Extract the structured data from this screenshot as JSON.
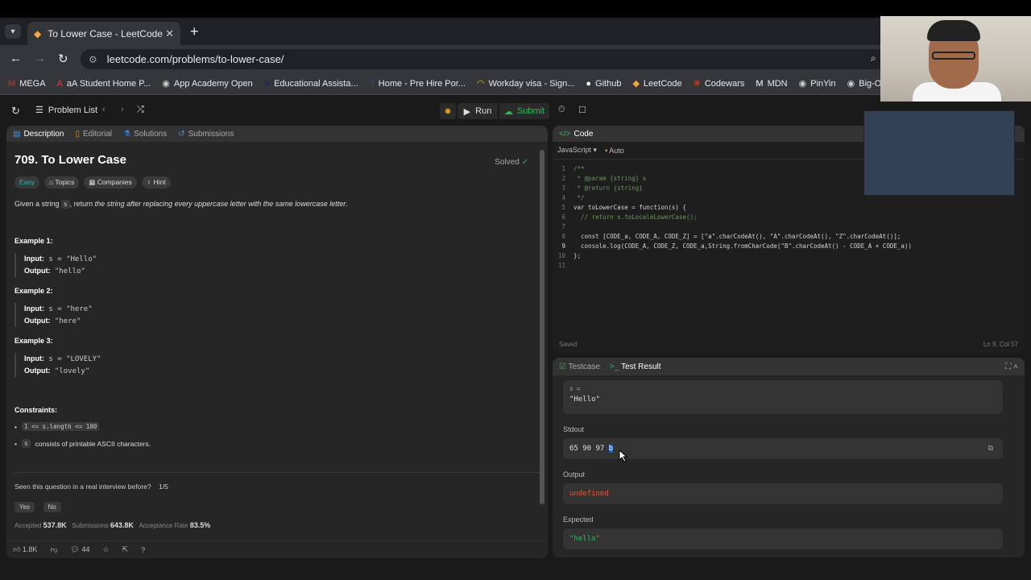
{
  "browser": {
    "tab_title": "To Lower Case - LeetCode",
    "url": "leetcode.com/problems/to-lower-case/",
    "bookmarks": [
      {
        "label": "MEGA",
        "icon": "mega-icon",
        "color": "#d9272e"
      },
      {
        "label": "aA Student Home P...",
        "icon": "aa-icon",
        "color": "#e03a3e"
      },
      {
        "label": "App Academy Open",
        "icon": "globe-icon",
        "color": "#cccccc"
      },
      {
        "label": "Educational Assista...",
        "icon": "visa-icon",
        "color": "#1a1f71"
      },
      {
        "label": "Home - Pre Hire Por...",
        "icon": "asknow-icon",
        "color": "#2a4b8d"
      },
      {
        "label": "Workday visa - Sign...",
        "icon": "workday-icon",
        "color": "#f5a623"
      },
      {
        "label": "Github",
        "icon": "github-icon",
        "color": "#ffffff"
      },
      {
        "label": "LeetCode",
        "icon": "leetcode-icon",
        "color": "#f3a93c"
      },
      {
        "label": "Codewars",
        "icon": "codewars-icon",
        "color": "#b1361e"
      },
      {
        "label": "MDN",
        "icon": "mdn-icon",
        "color": "#ffffff"
      },
      {
        "label": "PinYin",
        "icon": "globe-icon",
        "color": "#cccccc"
      },
      {
        "label": "Big-O",
        "icon": "globe-icon",
        "color": "#cccccc"
      }
    ]
  },
  "header": {
    "problem_list": "Problem List",
    "run": "Run",
    "submit": "Submit"
  },
  "left": {
    "tabs": [
      "Description",
      "Editorial",
      "Solutions",
      "Submissions"
    ],
    "title": "709. To Lower Case",
    "solved": "Solved",
    "chips": [
      "Easy",
      "Topics",
      "Companies",
      "Hint"
    ],
    "desc_pre": "Given a string",
    "desc_code": "s",
    "desc_mid": ", return",
    "desc_italic": "the string after replacing every uppercase letter with the same lowercase letter",
    "desc_end": ".",
    "examples": [
      {
        "heading": "Example 1:",
        "input_label": "Input:",
        "input": "s = \"Hello\"",
        "output_label": "Output:",
        "output": "\"hello\""
      },
      {
        "heading": "Example 2:",
        "input_label": "Input:",
        "input": "s = \"here\"",
        "output_label": "Output:",
        "output": "\"here\""
      },
      {
        "heading": "Example 3:",
        "input_label": "Input:",
        "input": "s = \"LOVELY\"",
        "output_label": "Output:",
        "output": "\"lovely\""
      }
    ],
    "constraints_heading": "Constraints:",
    "constraint1": "1 <= s.length <= 100",
    "constraint2_code": "s",
    "constraint2_text": "consists of printable ASCII characters.",
    "seen_q": "Seen this question in a real interview before?",
    "seen_count": "1/5",
    "yes": "Yes",
    "no": "No",
    "accepted_label": "Accepted",
    "accepted": "537.8K",
    "submissions_label": "Submissions",
    "submissions": "643.8K",
    "rate_label": "Acceptance Rate",
    "rate": "83.5%",
    "likes": "1.8K",
    "comments": "44"
  },
  "code": {
    "tab": "Code",
    "language": "JavaScript",
    "mode": "Auto",
    "lines": [
      "/**",
      " * @param {string} s",
      " * @return {string}",
      " */",
      "var toLowerCase = function(s) {",
      "  // return s.toLocaleLowerCase();",
      "",
      "  const [CODE_a, CODE_A, CODE_Z] = [\"a\".charCodeAt(), \"A\".charCodeAt(), \"Z\".charCodeAt()];",
      "  console.log(CODE_A, CODE_Z, CODE_a,String.fromCharCode(\"B\".charCodeAt() - CODE_A + CODE_a))",
      "};",
      ""
    ],
    "saved": "Saved",
    "position": "Ln 9, Col 57"
  },
  "test": {
    "tabs": [
      "Testcase",
      "Test Result"
    ],
    "input_label": "s =",
    "input_value": "\"Hello\"",
    "stdout_label": "Stdout",
    "stdout_value": "65 90 97",
    "stdout_selected": "b",
    "output_label": "Output",
    "output_value": "undefined",
    "expected_label": "Expected",
    "expected_value": "\"hello\""
  }
}
